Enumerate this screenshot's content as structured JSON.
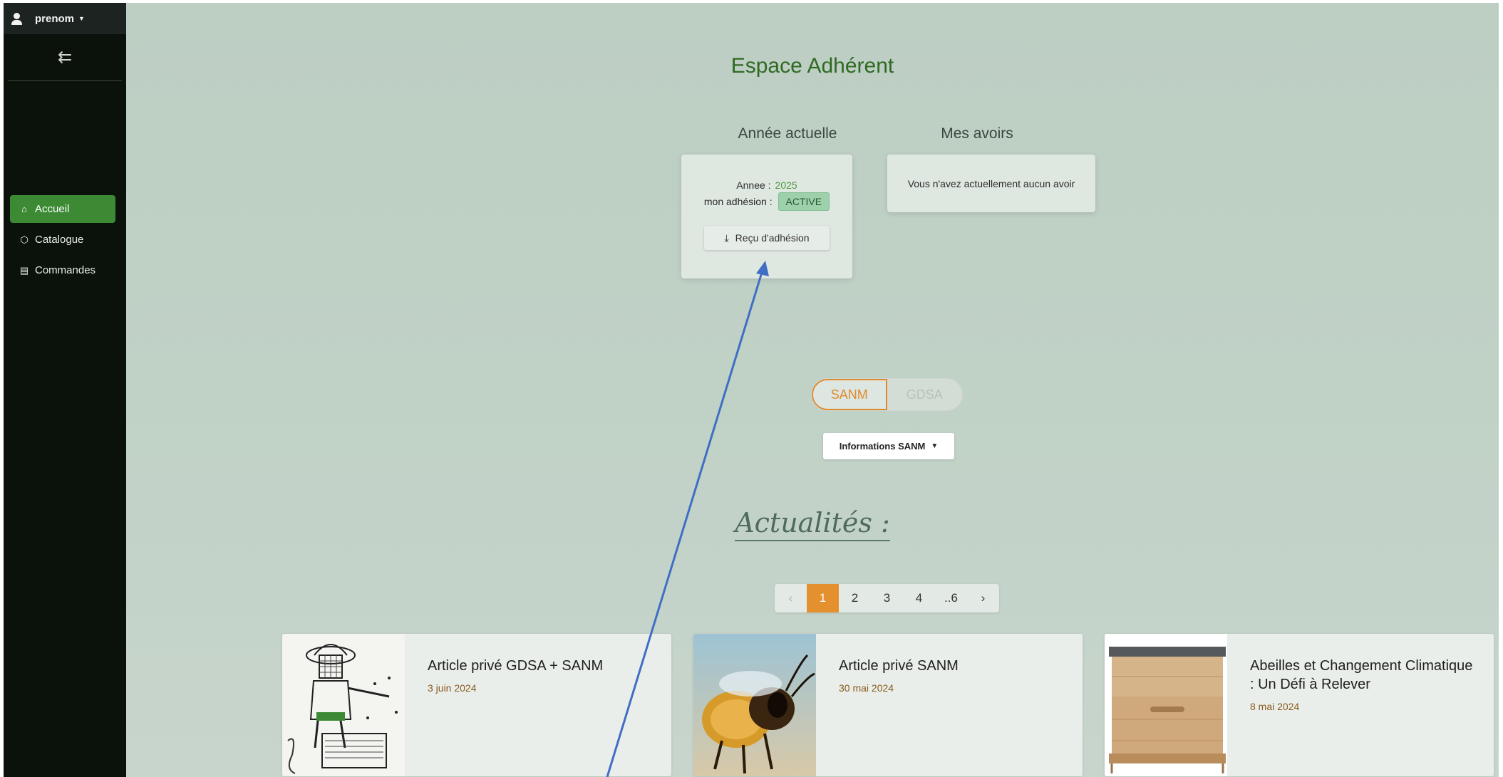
{
  "user": {
    "name": "prenom"
  },
  "sidebar": {
    "items": [
      {
        "label": "Accueil",
        "active": true
      },
      {
        "label": "Catalogue",
        "active": false
      },
      {
        "label": "Commandes",
        "active": false
      }
    ]
  },
  "page": {
    "title": "Espace Adhérent"
  },
  "annee": {
    "title": "Année actuelle",
    "year_label": "Annee :",
    "year_value": "2025",
    "status_label": "mon adhésion :",
    "status_value": "ACTIVE",
    "receipt_button": "Reçu d'adhésion"
  },
  "avoirs": {
    "title": "Mes avoirs",
    "message": "Vous n'avez actuellement aucun avoir"
  },
  "toggle": {
    "option1": "SANM",
    "option2": "GDSA",
    "selected": "SANM"
  },
  "info_button": "Informations SANM",
  "news": {
    "title": "Actualités :"
  },
  "pagination": {
    "pages": [
      "1",
      "2",
      "3",
      "4",
      "..6"
    ],
    "current": "1"
  },
  "articles": [
    {
      "title": "Article privé GDSA + SANM",
      "date": "3 juin 2024"
    },
    {
      "title": "Article privé SANM",
      "date": "30 mai 2024"
    },
    {
      "title": "Abeilles et Changement Climatique : Un Défi à Relever",
      "date": "8 mai 2024"
    }
  ],
  "colors": {
    "accent_green": "#3d8a35",
    "accent_orange": "#e4902f",
    "annotation_arrow": "#3f6fc4"
  }
}
